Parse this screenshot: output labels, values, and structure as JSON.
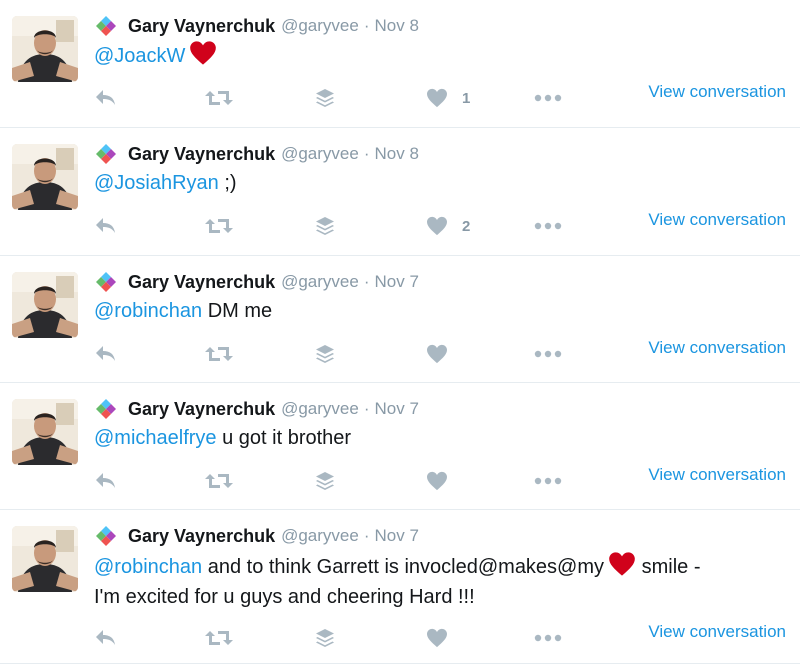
{
  "tweets": [
    {
      "name": "Gary Vaynerchuk",
      "handle": "@garyvee",
      "separator": "·",
      "date": "Nov 8",
      "mention": "@JoackW",
      "text_after": "",
      "text_line2": "",
      "has_heart_emoji": true,
      "like_count": "1",
      "view_conversation": "View conversation"
    },
    {
      "name": "Gary Vaynerchuk",
      "handle": "@garyvee",
      "separator": "·",
      "date": "Nov 8",
      "mention": "@JosiahRyan",
      "text_after": " ;)",
      "text_line2": "",
      "has_heart_emoji": false,
      "like_count": "2",
      "view_conversation": "View conversation"
    },
    {
      "name": "Gary Vaynerchuk",
      "handle": "@garyvee",
      "separator": "·",
      "date": "Nov 7",
      "mention": "@robinchan",
      "text_after": " DM me",
      "text_line2": "",
      "has_heart_emoji": false,
      "like_count": "",
      "view_conversation": "View conversation"
    },
    {
      "name": "Gary Vaynerchuk",
      "handle": "@garyvee",
      "separator": "·",
      "date": "Nov 7",
      "mention": "@michaelfrye",
      "text_after": " u got it brother",
      "text_line2": "",
      "has_heart_emoji": false,
      "like_count": "",
      "view_conversation": "View conversation"
    },
    {
      "name": "Gary Vaynerchuk",
      "handle": "@garyvee",
      "separator": "·",
      "date": "Nov 7",
      "mention": "@robinchan",
      "text_after": " and to think Garrett is invocled@makes@my",
      "text_after_heart": " smile -",
      "text_line2": "I'm excited for u guys and cheering Hard !!!",
      "has_heart_emoji": true,
      "like_count": "",
      "view_conversation": "View conversation"
    }
  ],
  "icons": {
    "reply": "reply-icon",
    "retweet": "retweet-icon",
    "buffer": "buffer-stack-icon",
    "like": "heart-icon",
    "more": "more-dots-icon",
    "app": "app-diamond-icon",
    "emoji": "red-heart-emoji"
  },
  "colors": {
    "link": "#1b95e0",
    "muted": "#8899a6",
    "icon": "#aab8c2",
    "heart_emoji": "#d0021b",
    "divider": "#e6ecf0"
  }
}
